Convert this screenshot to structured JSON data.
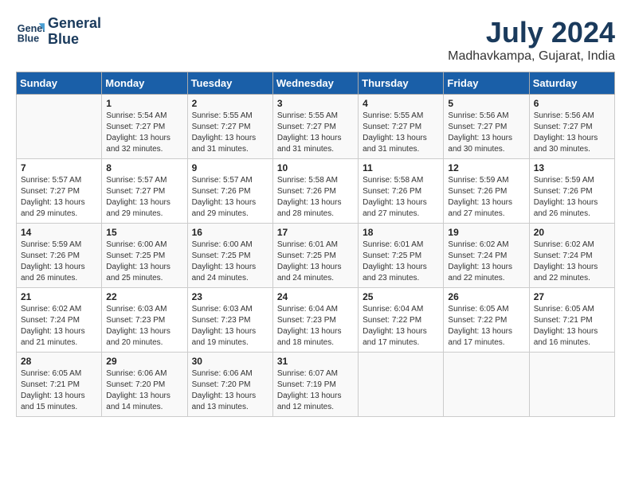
{
  "logo": {
    "line1": "General",
    "line2": "Blue"
  },
  "title": "July 2024",
  "location": "Madhavkampa, Gujarat, India",
  "headers": [
    "Sunday",
    "Monday",
    "Tuesday",
    "Wednesday",
    "Thursday",
    "Friday",
    "Saturday"
  ],
  "weeks": [
    [
      {
        "day": "",
        "text": ""
      },
      {
        "day": "1",
        "text": "Sunrise: 5:54 AM\nSunset: 7:27 PM\nDaylight: 13 hours\nand 32 minutes."
      },
      {
        "day": "2",
        "text": "Sunrise: 5:55 AM\nSunset: 7:27 PM\nDaylight: 13 hours\nand 31 minutes."
      },
      {
        "day": "3",
        "text": "Sunrise: 5:55 AM\nSunset: 7:27 PM\nDaylight: 13 hours\nand 31 minutes."
      },
      {
        "day": "4",
        "text": "Sunrise: 5:55 AM\nSunset: 7:27 PM\nDaylight: 13 hours\nand 31 minutes."
      },
      {
        "day": "5",
        "text": "Sunrise: 5:56 AM\nSunset: 7:27 PM\nDaylight: 13 hours\nand 30 minutes."
      },
      {
        "day": "6",
        "text": "Sunrise: 5:56 AM\nSunset: 7:27 PM\nDaylight: 13 hours\nand 30 minutes."
      }
    ],
    [
      {
        "day": "7",
        "text": "Sunrise: 5:57 AM\nSunset: 7:27 PM\nDaylight: 13 hours\nand 29 minutes."
      },
      {
        "day": "8",
        "text": "Sunrise: 5:57 AM\nSunset: 7:27 PM\nDaylight: 13 hours\nand 29 minutes."
      },
      {
        "day": "9",
        "text": "Sunrise: 5:57 AM\nSunset: 7:26 PM\nDaylight: 13 hours\nand 29 minutes."
      },
      {
        "day": "10",
        "text": "Sunrise: 5:58 AM\nSunset: 7:26 PM\nDaylight: 13 hours\nand 28 minutes."
      },
      {
        "day": "11",
        "text": "Sunrise: 5:58 AM\nSunset: 7:26 PM\nDaylight: 13 hours\nand 27 minutes."
      },
      {
        "day": "12",
        "text": "Sunrise: 5:59 AM\nSunset: 7:26 PM\nDaylight: 13 hours\nand 27 minutes."
      },
      {
        "day": "13",
        "text": "Sunrise: 5:59 AM\nSunset: 7:26 PM\nDaylight: 13 hours\nand 26 minutes."
      }
    ],
    [
      {
        "day": "14",
        "text": "Sunrise: 5:59 AM\nSunset: 7:26 PM\nDaylight: 13 hours\nand 26 minutes."
      },
      {
        "day": "15",
        "text": "Sunrise: 6:00 AM\nSunset: 7:25 PM\nDaylight: 13 hours\nand 25 minutes."
      },
      {
        "day": "16",
        "text": "Sunrise: 6:00 AM\nSunset: 7:25 PM\nDaylight: 13 hours\nand 24 minutes."
      },
      {
        "day": "17",
        "text": "Sunrise: 6:01 AM\nSunset: 7:25 PM\nDaylight: 13 hours\nand 24 minutes."
      },
      {
        "day": "18",
        "text": "Sunrise: 6:01 AM\nSunset: 7:25 PM\nDaylight: 13 hours\nand 23 minutes."
      },
      {
        "day": "19",
        "text": "Sunrise: 6:02 AM\nSunset: 7:24 PM\nDaylight: 13 hours\nand 22 minutes."
      },
      {
        "day": "20",
        "text": "Sunrise: 6:02 AM\nSunset: 7:24 PM\nDaylight: 13 hours\nand 22 minutes."
      }
    ],
    [
      {
        "day": "21",
        "text": "Sunrise: 6:02 AM\nSunset: 7:24 PM\nDaylight: 13 hours\nand 21 minutes."
      },
      {
        "day": "22",
        "text": "Sunrise: 6:03 AM\nSunset: 7:23 PM\nDaylight: 13 hours\nand 20 minutes."
      },
      {
        "day": "23",
        "text": "Sunrise: 6:03 AM\nSunset: 7:23 PM\nDaylight: 13 hours\nand 19 minutes."
      },
      {
        "day": "24",
        "text": "Sunrise: 6:04 AM\nSunset: 7:23 PM\nDaylight: 13 hours\nand 18 minutes."
      },
      {
        "day": "25",
        "text": "Sunrise: 6:04 AM\nSunset: 7:22 PM\nDaylight: 13 hours\nand 17 minutes."
      },
      {
        "day": "26",
        "text": "Sunrise: 6:05 AM\nSunset: 7:22 PM\nDaylight: 13 hours\nand 17 minutes."
      },
      {
        "day": "27",
        "text": "Sunrise: 6:05 AM\nSunset: 7:21 PM\nDaylight: 13 hours\nand 16 minutes."
      }
    ],
    [
      {
        "day": "28",
        "text": "Sunrise: 6:05 AM\nSunset: 7:21 PM\nDaylight: 13 hours\nand 15 minutes."
      },
      {
        "day": "29",
        "text": "Sunrise: 6:06 AM\nSunset: 7:20 PM\nDaylight: 13 hours\nand 14 minutes."
      },
      {
        "day": "30",
        "text": "Sunrise: 6:06 AM\nSunset: 7:20 PM\nDaylight: 13 hours\nand 13 minutes."
      },
      {
        "day": "31",
        "text": "Sunrise: 6:07 AM\nSunset: 7:19 PM\nDaylight: 13 hours\nand 12 minutes."
      },
      {
        "day": "",
        "text": ""
      },
      {
        "day": "",
        "text": ""
      },
      {
        "day": "",
        "text": ""
      }
    ]
  ]
}
